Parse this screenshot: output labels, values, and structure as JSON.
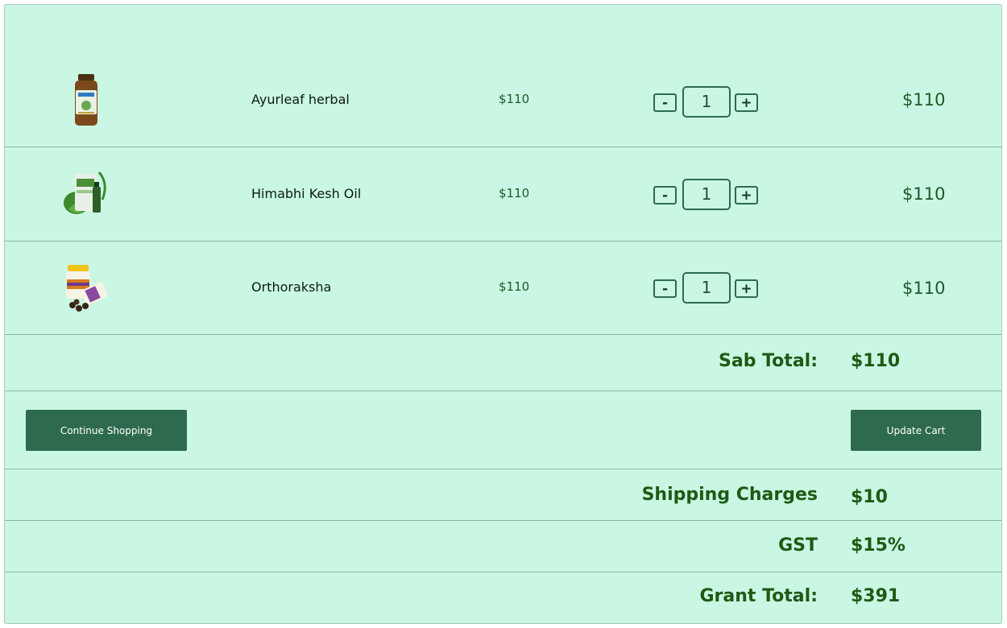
{
  "cart": {
    "items": [
      {
        "name": "Ayurleaf herbal",
        "price": "$110",
        "quantity": "1",
        "total": "$110",
        "image_icon": "herbal-jar-icon"
      },
      {
        "name": "Himabhi Kesh Oil",
        "price": "$110",
        "quantity": "1",
        "total": "$110",
        "image_icon": "oil-bottle-icon"
      },
      {
        "name": "Orthoraksha",
        "price": "$110",
        "quantity": "1",
        "total": "$110",
        "image_icon": "pill-jar-icon"
      }
    ],
    "minus_label": "-",
    "plus_label": "+"
  },
  "summary": {
    "subtotal_label": "Sab Total:",
    "subtotal_value": "$110",
    "shipping_label": "Shipping Charges",
    "shipping_value": "$10",
    "gst_label": "GST",
    "gst_value": "$15%",
    "grand_total_label": "Grant Total:",
    "grand_total_value": "$391"
  },
  "actions": {
    "continue_label": "Continue Shopping",
    "update_label": "Update Cart"
  },
  "colors": {
    "background": "#c9f7e3",
    "accent": "#2e6b4e",
    "text_green": "#1e5a14"
  }
}
